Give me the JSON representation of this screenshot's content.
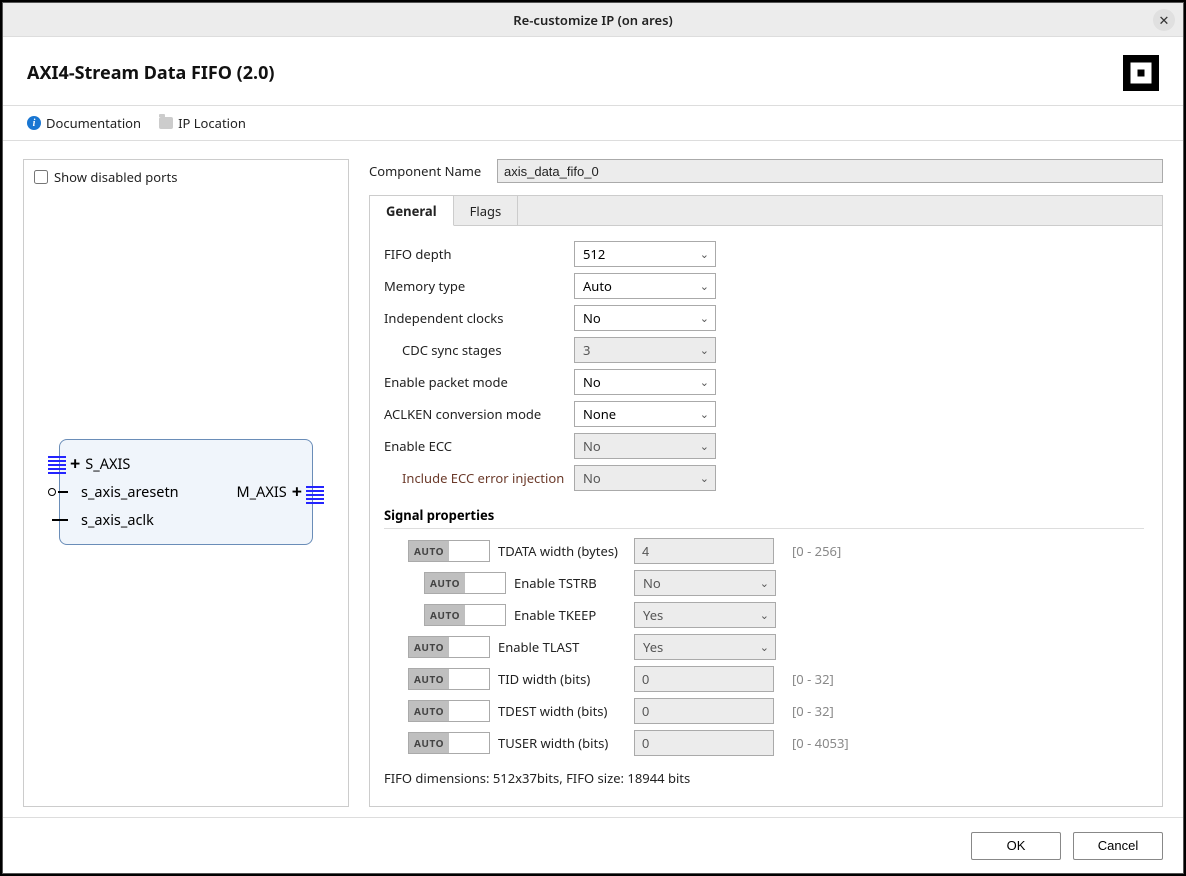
{
  "titlebar": {
    "title": "Re-customize IP (on ares)"
  },
  "header": {
    "ip_name": "AXI4-Stream Data FIFO (2.0)"
  },
  "linkbar": {
    "doc": "Documentation",
    "iploc": "IP Location"
  },
  "left": {
    "show_disabled": "Show disabled ports",
    "ports": {
      "s_axis": "S_AXIS",
      "aresetn": "s_axis_aresetn",
      "aclk": "s_axis_aclk",
      "m_axis": "M_AXIS"
    }
  },
  "compname": {
    "label": "Component Name",
    "value": "axis_data_fifo_0"
  },
  "tabs": {
    "general": "General",
    "flags": "Flags"
  },
  "general": {
    "fifo_depth": {
      "label": "FIFO depth",
      "value": "512"
    },
    "memory_type": {
      "label": "Memory type",
      "value": "Auto"
    },
    "indep_clocks": {
      "label": "Independent clocks",
      "value": "No"
    },
    "cdc_sync": {
      "label": "CDC sync stages",
      "value": "3"
    },
    "packet_mode": {
      "label": "Enable packet mode",
      "value": "No"
    },
    "aclken": {
      "label": "ACLKEN conversion mode",
      "value": "None"
    },
    "enable_ecc": {
      "label": "Enable ECC",
      "value": "No"
    },
    "ecc_inj": {
      "label": "Include ECC error injection",
      "value": "No"
    }
  },
  "sigprops": {
    "heading": "Signal properties",
    "auto": "AUTO",
    "tdata": {
      "label": "TDATA width (bytes)",
      "value": "4",
      "range": "[0 - 256]"
    },
    "tstrb": {
      "label": "Enable TSTRB",
      "value": "No"
    },
    "tkeep": {
      "label": "Enable TKEEP",
      "value": "Yes"
    },
    "tlast": {
      "label": "Enable TLAST",
      "value": "Yes"
    },
    "tid": {
      "label": "TID width (bits)",
      "value": "0",
      "range": "[0 - 32]"
    },
    "tdest": {
      "label": "TDEST width (bits)",
      "value": "0",
      "range": "[0 - 32]"
    },
    "tuser": {
      "label": "TUSER width (bits)",
      "value": "0",
      "range": "[0 - 4053]"
    }
  },
  "dims": "FIFO dimensions: 512x37bits, FIFO size: 18944 bits",
  "footer": {
    "ok": "OK",
    "cancel": "Cancel"
  }
}
